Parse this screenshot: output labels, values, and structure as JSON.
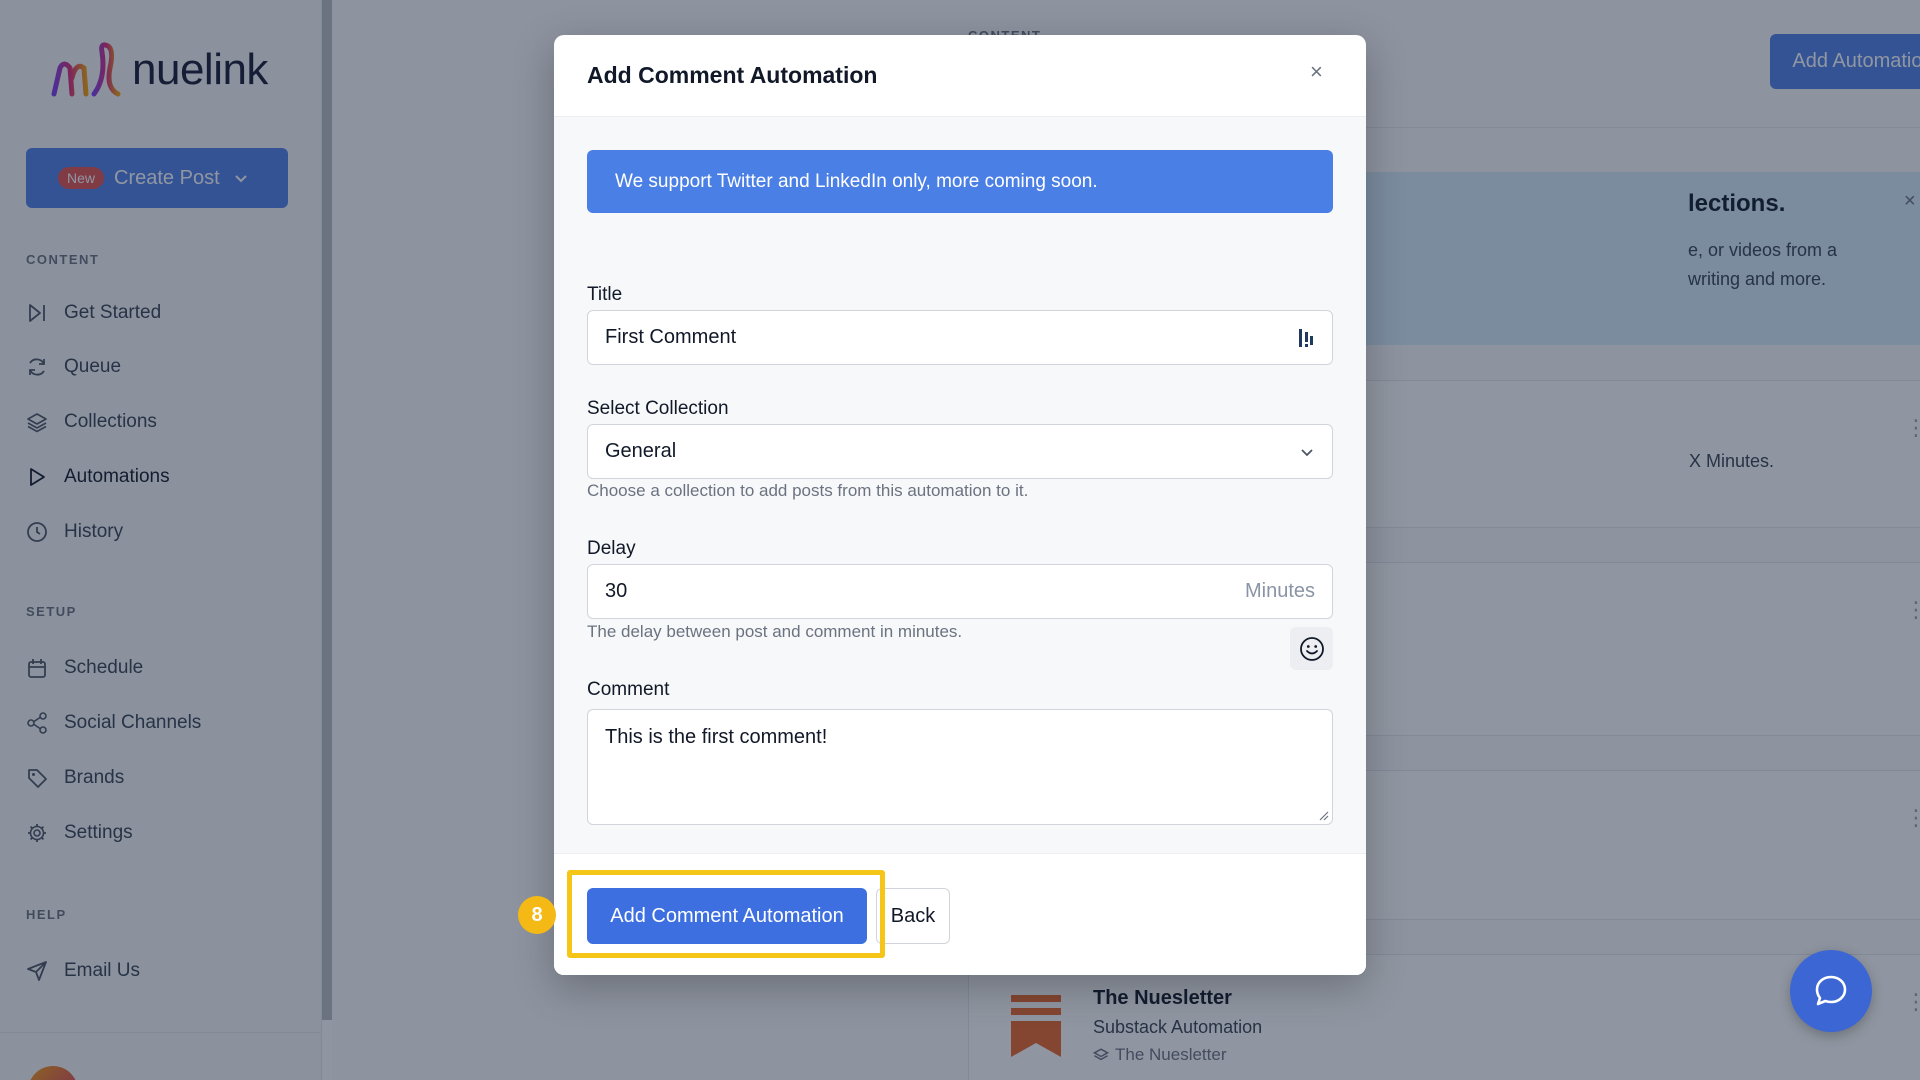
{
  "app": {
    "logo_text": "nuelink",
    "brand_color": "#4f7fe8"
  },
  "sidebar": {
    "create_post": {
      "badge": "New",
      "label": "Create Post",
      "icon": "chevron-down-icon"
    },
    "sections": {
      "content": "CONTENT",
      "setup": "SETUP",
      "help": "HELP"
    },
    "items": [
      {
        "label": "Get Started",
        "icon": "skip-forward-icon"
      },
      {
        "label": "Queue",
        "icon": "refresh-icon"
      },
      {
        "label": "Collections",
        "icon": "layers-icon"
      },
      {
        "label": "Automations",
        "icon": "play-icon",
        "active": true
      },
      {
        "label": "History",
        "icon": "clock-icon"
      },
      {
        "label": "Schedule",
        "icon": "calendar-icon"
      },
      {
        "label": "Social Channels",
        "icon": "share-icon"
      },
      {
        "label": "Brands",
        "icon": "tag-icon"
      },
      {
        "label": "Settings",
        "icon": "gear-icon"
      },
      {
        "label": "Email Us",
        "icon": "send-icon"
      }
    ]
  },
  "page": {
    "section_label": "CONTENT",
    "add_automation_label": "Add Automation",
    "info_card": {
      "title_fragment": "lections.",
      "body_line1": "e, or videos from a",
      "body_line2": "writing and more."
    },
    "card1_text": "X Minutes.",
    "nuesletter": {
      "title": "The Nuesletter",
      "subtitle": "Substack Automation",
      "collection": "The Nuesletter"
    }
  },
  "modal": {
    "title": "Add Comment Automation",
    "alert": "We support Twitter and LinkedIn only, more coming soon.",
    "title_field": {
      "label": "Title",
      "value": "First Comment"
    },
    "collection_field": {
      "label": "Select Collection",
      "value": "General",
      "help": "Choose a collection to add posts from this automation to it."
    },
    "delay_field": {
      "label": "Delay",
      "value": "30",
      "unit": "Minutes",
      "help": "The delay between post and comment in minutes."
    },
    "comment_field": {
      "label": "Comment",
      "value": "This is the first comment!"
    },
    "submit_label": "Add Comment Automation",
    "back_label": "Back"
  },
  "tutorial": {
    "step": "8",
    "highlight_color": "#f5c518"
  }
}
